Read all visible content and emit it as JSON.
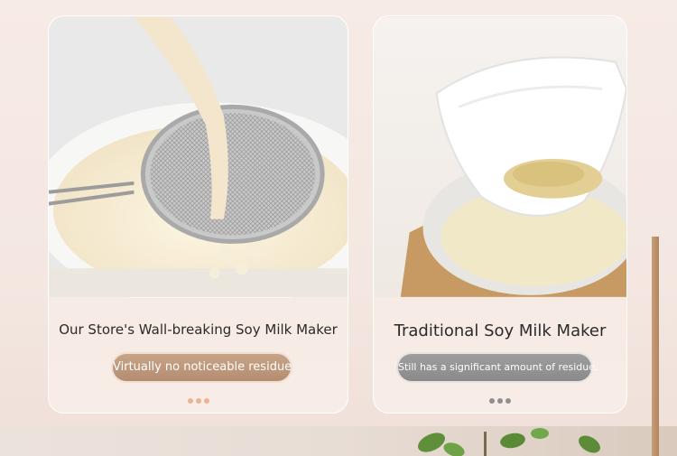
{
  "colors": {
    "accent_warm": "#c7a487",
    "accent_gray": "#9e9e9e",
    "dot_warm": "#e9b494",
    "dot_gray": "#8f8f8f",
    "card_border": "#ffffff"
  },
  "cards": [
    {
      "caption": "Our Store's Wall-breaking Soy Milk Maker",
      "badge": "Virtually no noticeable residue",
      "image": "soy-milk-poured-through-fine-strainer",
      "dots": 3
    },
    {
      "caption": "Traditional Soy Milk Maker",
      "badge": "Still has a significant amount of residue.",
      "image": "cloth-filter-with-okara-residue",
      "dots": 3
    }
  ]
}
